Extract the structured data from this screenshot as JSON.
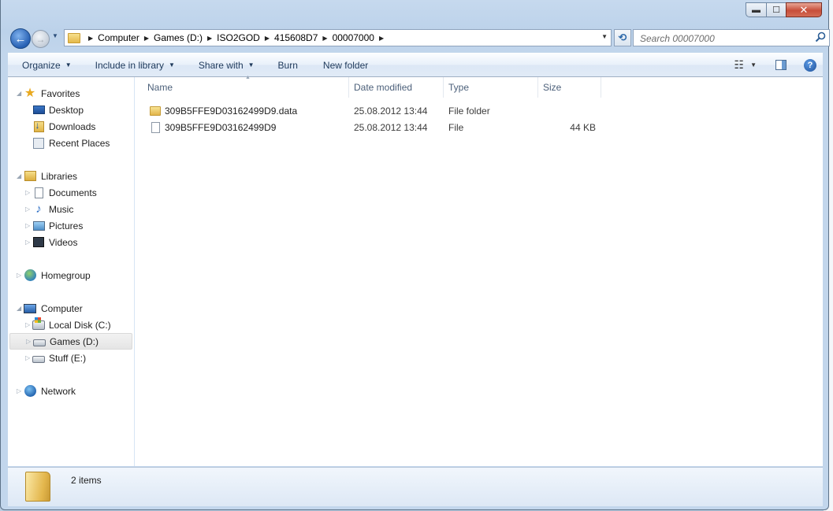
{
  "window": {
    "caption_buttons": {
      "minimize": "▬",
      "maximize": "☐",
      "close": "✕"
    }
  },
  "navigation": {
    "back_glyph": "←",
    "forward_glyph": "→",
    "recent_glyph": "▼",
    "address": {
      "crumbs": [
        "Computer",
        "Games (D:)",
        "ISO2GOD",
        "415608D7",
        "00007000"
      ],
      "separator": "▶",
      "dropdown_glyph": "▼"
    },
    "refresh_glyph": "⟲",
    "search": {
      "placeholder": "Search 00007000"
    }
  },
  "toolbar": {
    "buttons": [
      {
        "label": "Organize",
        "dropdown": true
      },
      {
        "label": "Include in library",
        "dropdown": true
      },
      {
        "label": "Share with",
        "dropdown": true
      },
      {
        "label": "Burn",
        "dropdown": false
      },
      {
        "label": "New folder",
        "dropdown": false
      }
    ],
    "caret": "▼",
    "views_glyph": "☷",
    "help_glyph": "?"
  },
  "sidebar": {
    "groups": [
      {
        "label": "Favorites",
        "icon": "star-icon",
        "items": [
          {
            "label": "Desktop",
            "icon": "desktop-icon"
          },
          {
            "label": "Downloads",
            "icon": "downloads-icon"
          },
          {
            "label": "Recent Places",
            "icon": "recent-places-icon"
          }
        ]
      },
      {
        "label": "Libraries",
        "icon": "libraries-icon",
        "items": [
          {
            "label": "Documents",
            "icon": "documents-icon"
          },
          {
            "label": "Music",
            "icon": "music-icon"
          },
          {
            "label": "Pictures",
            "icon": "pictures-icon"
          },
          {
            "label": "Videos",
            "icon": "videos-icon"
          }
        ]
      },
      {
        "label": "Homegroup",
        "icon": "homegroup-icon",
        "items": []
      },
      {
        "label": "Computer",
        "icon": "computer-icon",
        "items": [
          {
            "label": "Local Disk (C:)",
            "icon": "local-disk-icon"
          },
          {
            "label": "Games (D:)",
            "icon": "drive-icon",
            "selected": true
          },
          {
            "label": "Stuff (E:)",
            "icon": "drive-icon"
          }
        ]
      },
      {
        "label": "Network",
        "icon": "network-icon",
        "items": []
      }
    ]
  },
  "file_list": {
    "columns": [
      "Name",
      "Date modified",
      "Type",
      "Size"
    ],
    "sort_glyph": "▲",
    "rows": [
      {
        "name": "309B5FFE9D03162499D9.data",
        "date": "25.08.2012 13:44",
        "type": "File folder",
        "size": "",
        "icon": "folder-icon"
      },
      {
        "name": "309B5FFE9D03162499D9",
        "date": "25.08.2012 13:44",
        "type": "File",
        "size": "44 KB",
        "icon": "file-icon"
      }
    ]
  },
  "details": {
    "item_count": "2 items"
  }
}
